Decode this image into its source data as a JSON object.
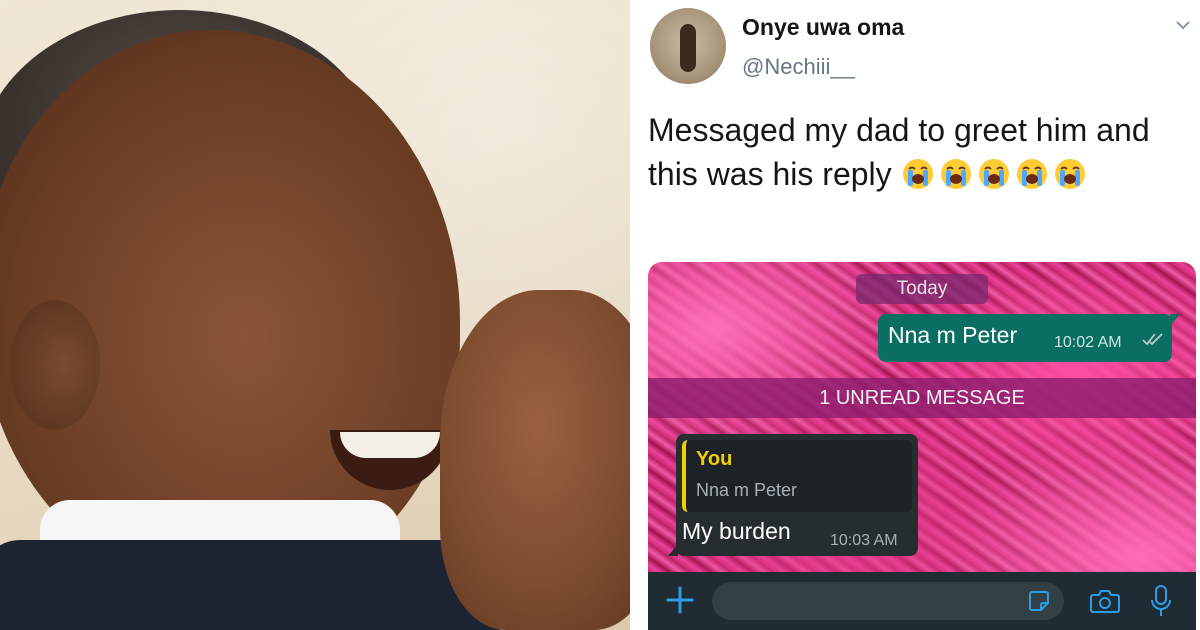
{
  "tweet": {
    "display_name": "Onye uwa oma",
    "handle": "@Nechiii__",
    "text": "Messaged my dad to greet him and this was his reply",
    "emoji_count": 5
  },
  "chat": {
    "date_chip": "Today",
    "outgoing": {
      "text": "Nna m Peter",
      "time": "10:02 AM"
    },
    "unread_banner": "1 UNREAD MESSAGE",
    "incoming": {
      "quote_author": "You",
      "quote_text": "Nna m Peter",
      "text": "My burden",
      "time": "10:03 AM"
    },
    "input_icons": [
      "plus-icon",
      "sticker-icon",
      "camera-icon",
      "microphone-icon"
    ]
  },
  "colors": {
    "accent_green": "#0b6e62",
    "quote_yellow": "#f0d000",
    "icon_blue": "#1da1f2"
  }
}
